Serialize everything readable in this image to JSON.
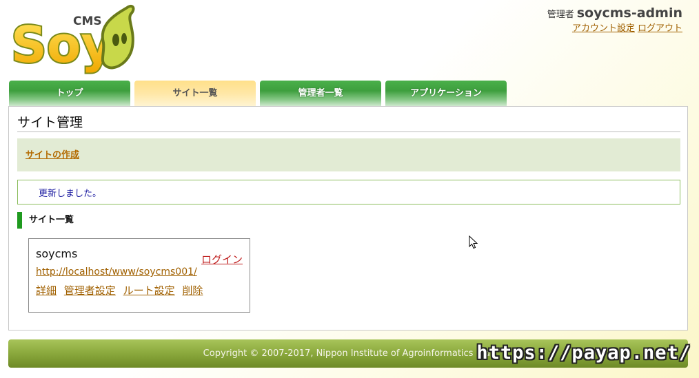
{
  "brand": {
    "logo_text": "Soy",
    "logo_sup": "CMS"
  },
  "admin": {
    "role_label": "管理者",
    "username": "soycms-admin",
    "account_settings": "アカウント設定",
    "logout": "ログアウト"
  },
  "tabs": [
    {
      "label": "トップ",
      "active": false
    },
    {
      "label": "サイト一覧",
      "active": true
    },
    {
      "label": "管理者一覧",
      "active": false
    },
    {
      "label": "アプリケーション",
      "active": false
    }
  ],
  "page": {
    "title": "サイト管理",
    "create_site_link": "サイトの作成",
    "message": "更新しました。",
    "section_title": "サイト一覧"
  },
  "site": {
    "name": "soycms",
    "login": "ログイン",
    "url": "http://localhost/www/soycms001/",
    "actions": [
      "詳細",
      "管理者設定",
      "ルート設定",
      "削除"
    ]
  },
  "footer": {
    "copyright": "Copyright © 2007-2017, Nippon Institute of Agroinformatics Ltd."
  },
  "watermark": "https://payap.net/",
  "colors": {
    "tab_green": "#3e9f3e",
    "tab_active": "#ffe08a",
    "footer": "#8aa83c",
    "link": "#a06000"
  }
}
